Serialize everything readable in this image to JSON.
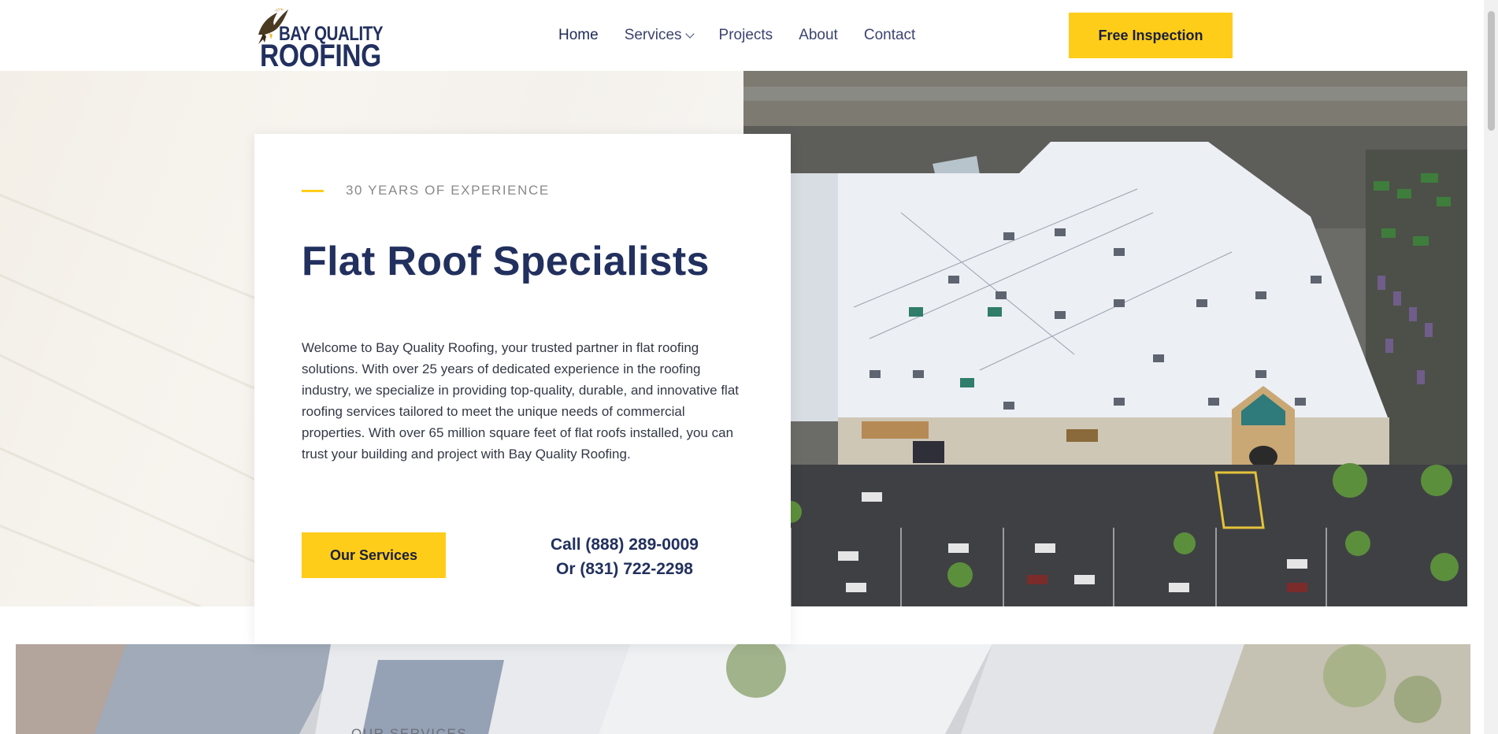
{
  "header": {
    "logo": {
      "line1": "BAY QUALITY",
      "line2": "ROOFING"
    },
    "nav": [
      {
        "label": "Home",
        "active": true
      },
      {
        "label": "Services",
        "has_dropdown": true
      },
      {
        "label": "Projects"
      },
      {
        "label": "About"
      },
      {
        "label": "Contact"
      }
    ],
    "cta_label": "Free Inspection"
  },
  "hero": {
    "eyebrow": "30 YEARS OF EXPERIENCE",
    "title": "Flat Roof Specialists",
    "description": "Welcome to Bay Quality Roofing, your trusted partner in flat roofing solutions. With over 25 years of dedicated experience in the roofing industry, we specialize in providing top-quality, durable, and innovative flat roofing services tailored to meet the unique needs of commercial properties. With over 65 million square feet of flat roofs installed, you can trust your building and project with Bay Quality Roofing.",
    "services_button": "Our Services",
    "phone_primary": "Call (888) 289-0009",
    "phone_secondary": "Or (831) 722-2298"
  },
  "lower": {
    "caption_partial": "OUR SERVICES"
  },
  "colors": {
    "navy": "#22305f",
    "accent_yellow": "#fecd1a",
    "text_body": "#333846",
    "eyebrow_gray": "#8a8a8a"
  },
  "icons": {
    "logo_mark": "eagle-icon",
    "dropdown": "chevron-down-icon"
  }
}
